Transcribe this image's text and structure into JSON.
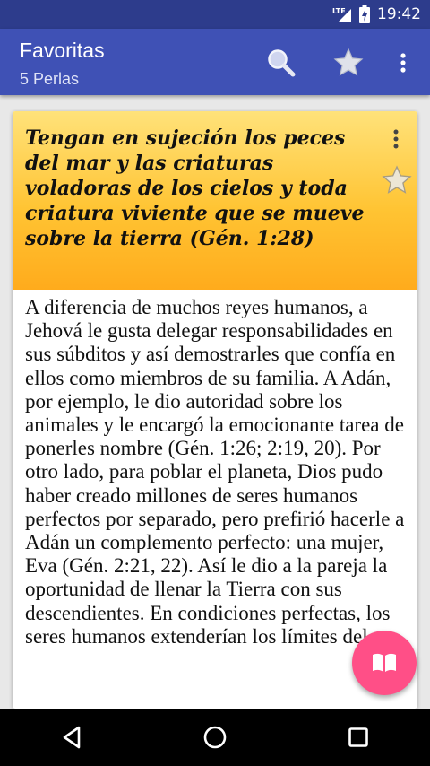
{
  "status_bar": {
    "network": "LTE",
    "time": "19:42"
  },
  "app_bar": {
    "title": "Favoritas",
    "subtitle": "5 Perlas",
    "icons": [
      "search-icon",
      "star-icon",
      "overflow-menu-icon"
    ]
  },
  "card": {
    "title": "Tengan en sujeción los peces del mar y las criaturas voladoras de los cielos y toda criatura viviente que se mueve sobre la tierra (Gén. 1:28)",
    "body": "A diferencia de muchos reyes humanos, a Jehová le gusta delegar responsabilidades en sus súbditos y así demostrarles que confía en ellos como miembros de su familia. A Adán, por ejemplo, le dio autoridad sobre los animales y le encargó la emocionante tarea de ponerles nombre (Gén. 1:26; 2:19, 20). Por otro lado, para poblar el planeta, Dios pudo haber creado millones de seres humanos perfectos por separado, pero prefirió hacerle a Adán un complemento perfecto: una mujer, Eva (Gén. 2:21, 22). Así le dio a la pareja la oportunidad de llenar la Tierra con sus descendientes. En condiciones perfectas, los seres humanos extenderían los límites del",
    "header_gradient": [
      "#ffe27a",
      "#ffab1c"
    ]
  },
  "fab": {
    "icon": "open-book-icon",
    "color": "#ff4f87"
  },
  "colors": {
    "primary": "#3f51b5",
    "primary_dark": "#2d3c8c"
  }
}
